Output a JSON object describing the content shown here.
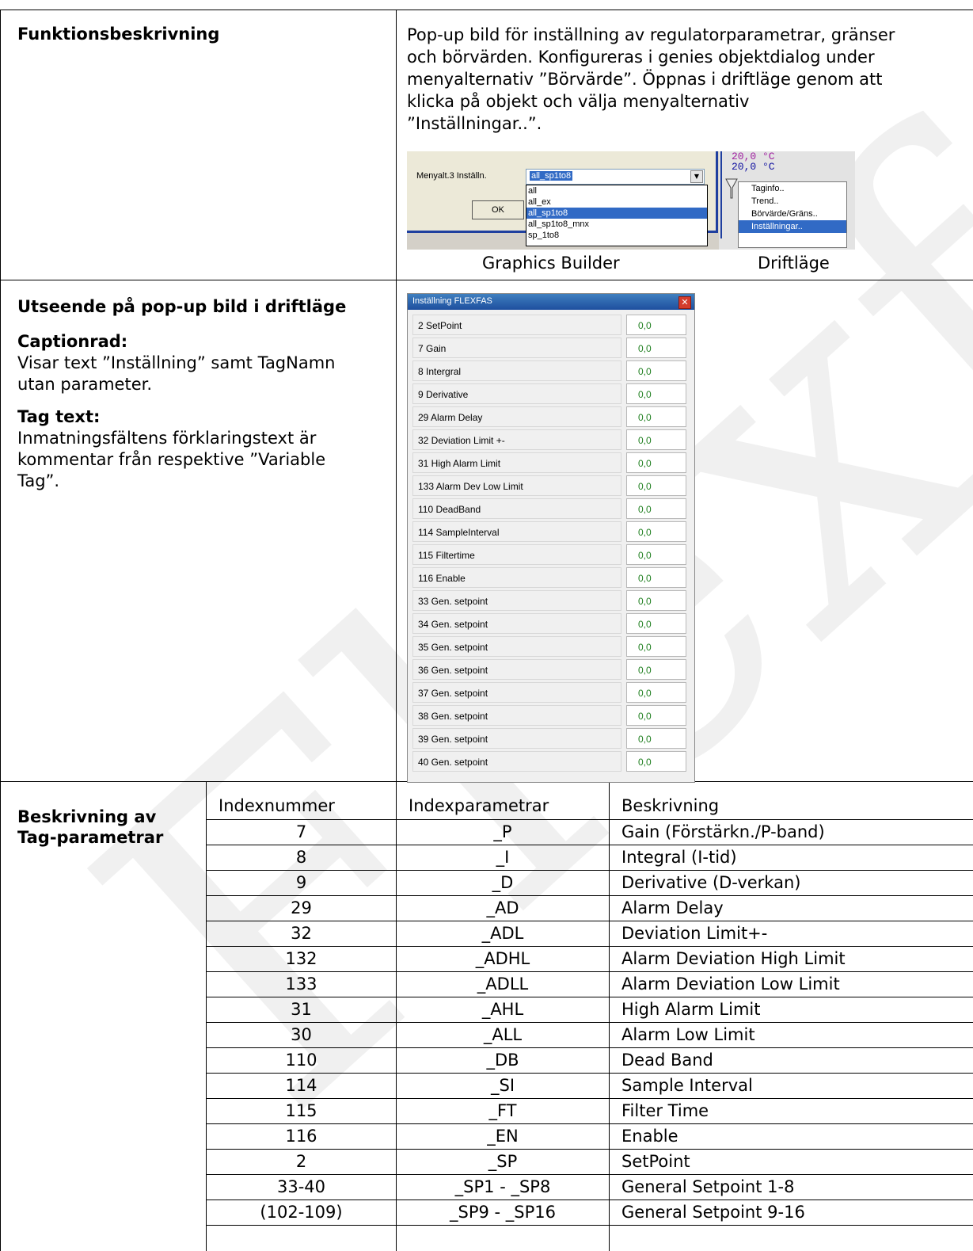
{
  "section1": {
    "heading": "Funktionsbeskrivning",
    "description": [
      "Pop-up bild för inställning av regulatorparametrar, gränser",
      "och börvärden. Konfigureras i genies objektdialog under",
      "menyalternativ ”Börvärde”. Öppnas i driftläge genom att",
      "klicka på objekt och välja menyalternativ",
      "”Inställningar..”."
    ],
    "caption_left": "Graphics Builder",
    "caption_right": "Driftläge"
  },
  "graphics_builder": {
    "label": "Menyalt.3 Inställn.",
    "combo_value": "all_sp1to8",
    "ok_label": "OK",
    "options": [
      "all",
      "all_ex",
      "all_sp1to8",
      "all_sp1to8_mnx",
      "sp_1to8"
    ],
    "selected_option": "all_sp1to8"
  },
  "driftlage": {
    "value1": "20,0 °C",
    "value2": "20,0 °C",
    "menu": [
      "Taginfo..",
      "Trend..",
      "Börvärde/Gräns..",
      "Inställningar.."
    ],
    "selected_menu": "Inställningar.."
  },
  "section2": {
    "heading": "Utseende på pop-up bild i driftläge",
    "sub1_title": "Captionrad:",
    "sub1_line1": "Visar text ”Inställning” samt TagNamn",
    "sub1_line2": "utan parameter.",
    "sub2_title": "Tag text:",
    "sub2_line1": "Inmatningsfältens förklaringstext är",
    "sub2_line2": "kommentar från respektive ”Variable",
    "sub2_line3": "Tag”."
  },
  "popup": {
    "title": "Inställning FLEXFAS",
    "close_symbol": "✕",
    "rows": [
      {
        "label": "2 SetPoint",
        "value": "0,0"
      },
      {
        "label": "7 Gain",
        "value": "0,0"
      },
      {
        "label": "8 Intergral",
        "value": "0,0"
      },
      {
        "label": "9 Derivative",
        "value": "0,0"
      },
      {
        "label": "29 Alarm Delay",
        "value": "0,0"
      },
      {
        "label": "32 Deviation Limit +-",
        "value": "0,0"
      },
      {
        "label": "31 High Alarm Limit",
        "value": "0,0"
      },
      {
        "label": "133 Alarm Dev Low Limit",
        "value": "0,0"
      },
      {
        "label": "110 DeadBand",
        "value": "0,0"
      },
      {
        "label": "114 SampleInterval",
        "value": "0,0"
      },
      {
        "label": "115 Filtertime",
        "value": "0,0"
      },
      {
        "label": "116 Enable",
        "value": "0,0"
      },
      {
        "label": "33 Gen. setpoint",
        "value": "0,0"
      },
      {
        "label": "34 Gen. setpoint",
        "value": "0,0"
      },
      {
        "label": "35 Gen. setpoint",
        "value": "0,0"
      },
      {
        "label": "36 Gen. setpoint",
        "value": "0,0"
      },
      {
        "label": "37 Gen. setpoint",
        "value": "0,0"
      },
      {
        "label": "38 Gen. setpoint",
        "value": "0,0"
      },
      {
        "label": "39 Gen. setpoint",
        "value": "0,0"
      },
      {
        "label": "40 Gen. setpoint",
        "value": "0,0"
      }
    ]
  },
  "section3": {
    "heading_line1": "Beskrivning av",
    "heading_line2": "Tag-parametrar",
    "columns": [
      "Indexnummer",
      "Indexparametrar",
      "Beskrivning"
    ],
    "rows": [
      [
        "7",
        "_P",
        "Gain (Förstärkn./P-band)"
      ],
      [
        "8",
        "_I",
        "Integral (I-tid)"
      ],
      [
        "9",
        "_D",
        "Derivative (D-verkan)"
      ],
      [
        "29",
        "_AD",
        "Alarm Delay"
      ],
      [
        "32",
        "_ADL",
        "Deviation Limit+-"
      ],
      [
        "132",
        "_ADHL",
        "Alarm Deviation High Limit"
      ],
      [
        "133",
        "_ADLL",
        "Alarm Deviation Low Limit"
      ],
      [
        "31",
        "_AHL",
        "High Alarm Limit"
      ],
      [
        "30",
        "_ALL",
        "Alarm Low Limit"
      ],
      [
        "110",
        "_DB",
        "Dead Band"
      ],
      [
        "114",
        "_SI",
        "Sample Interval"
      ],
      [
        "115",
        "_FT",
        "Filter Time"
      ],
      [
        "116",
        "_EN",
        "Enable"
      ],
      [
        "2",
        "_SP",
        "SetPoint"
      ],
      [
        "33-40",
        "_SP1 - _SP8",
        "General Setpoint 1-8"
      ],
      [
        "(102-109)",
        "_SP9  - _SP16",
        "General Setpoint 9-16"
      ],
      [
        "",
        "",
        ""
      ]
    ]
  },
  "watermark_text": "Flexfas"
}
